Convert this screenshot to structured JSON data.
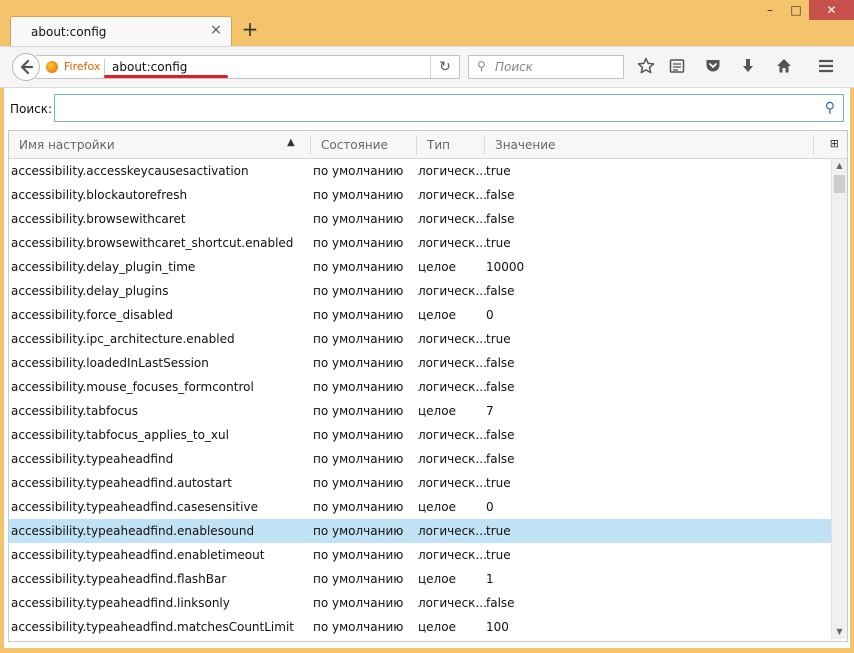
{
  "tab": {
    "title": "about:config",
    "close": "×",
    "new_tab": "+"
  },
  "window_controls": {
    "minimize": "–",
    "maximize": "□",
    "close": "✕"
  },
  "navbar": {
    "brand": "Firefox",
    "url": "about:config",
    "reload": "↻",
    "search_placeholder": "Поиск",
    "search_icon": "⚲"
  },
  "filter": {
    "label": "Поиск:",
    "value": "",
    "icon": "⚲"
  },
  "columns": [
    "Имя настройки",
    "Состояние",
    "Тип",
    "Значение"
  ],
  "sort_arrow": "▲",
  "col_picker": "⊞",
  "accent_colors": {
    "titlebar": "#f3c46b",
    "selected_row": "#c1e2f5",
    "close_button": "#c7504c",
    "url_underline": "#e02020"
  },
  "rows": [
    {
      "name": "accessibility.accesskeycausesactivation",
      "state": "по умолчанию",
      "type": "логическ...",
      "value": "true"
    },
    {
      "name": "accessibility.blockautorefresh",
      "state": "по умолчанию",
      "type": "логическ...",
      "value": "false"
    },
    {
      "name": "accessibility.browsewithcaret",
      "state": "по умолчанию",
      "type": "логическ...",
      "value": "false"
    },
    {
      "name": "accessibility.browsewithcaret_shortcut.enabled",
      "state": "по умолчанию",
      "type": "логическ...",
      "value": "true"
    },
    {
      "name": "accessibility.delay_plugin_time",
      "state": "по умолчанию",
      "type": "целое",
      "value": "10000"
    },
    {
      "name": "accessibility.delay_plugins",
      "state": "по умолчанию",
      "type": "логическ...",
      "value": "false"
    },
    {
      "name": "accessibility.force_disabled",
      "state": "по умолчанию",
      "type": "целое",
      "value": "0"
    },
    {
      "name": "accessibility.ipc_architecture.enabled",
      "state": "по умолчанию",
      "type": "логическ...",
      "value": "true"
    },
    {
      "name": "accessibility.loadedInLastSession",
      "state": "по умолчанию",
      "type": "логическ...",
      "value": "false"
    },
    {
      "name": "accessibility.mouse_focuses_formcontrol",
      "state": "по умолчанию",
      "type": "логическ...",
      "value": "false"
    },
    {
      "name": "accessibility.tabfocus",
      "state": "по умолчанию",
      "type": "целое",
      "value": "7"
    },
    {
      "name": "accessibility.tabfocus_applies_to_xul",
      "state": "по умолчанию",
      "type": "логическ...",
      "value": "false"
    },
    {
      "name": "accessibility.typeaheadfind",
      "state": "по умолчанию",
      "type": "логическ...",
      "value": "false"
    },
    {
      "name": "accessibility.typeaheadfind.autostart",
      "state": "по умолчанию",
      "type": "логическ...",
      "value": "true"
    },
    {
      "name": "accessibility.typeaheadfind.casesensitive",
      "state": "по умолчанию",
      "type": "целое",
      "value": "0"
    },
    {
      "name": "accessibility.typeaheadfind.enablesound",
      "state": "по умолчанию",
      "type": "логическ...",
      "value": "true",
      "selected": true
    },
    {
      "name": "accessibility.typeaheadfind.enabletimeout",
      "state": "по умолчанию",
      "type": "логическ...",
      "value": "true"
    },
    {
      "name": "accessibility.typeaheadfind.flashBar",
      "state": "по умолчанию",
      "type": "целое",
      "value": "1"
    },
    {
      "name": "accessibility.typeaheadfind.linksonly",
      "state": "по умолчанию",
      "type": "логическ...",
      "value": "false"
    },
    {
      "name": "accessibility.typeaheadfind.matchesCountLimit",
      "state": "по умолчанию",
      "type": "целое",
      "value": "100"
    }
  ]
}
